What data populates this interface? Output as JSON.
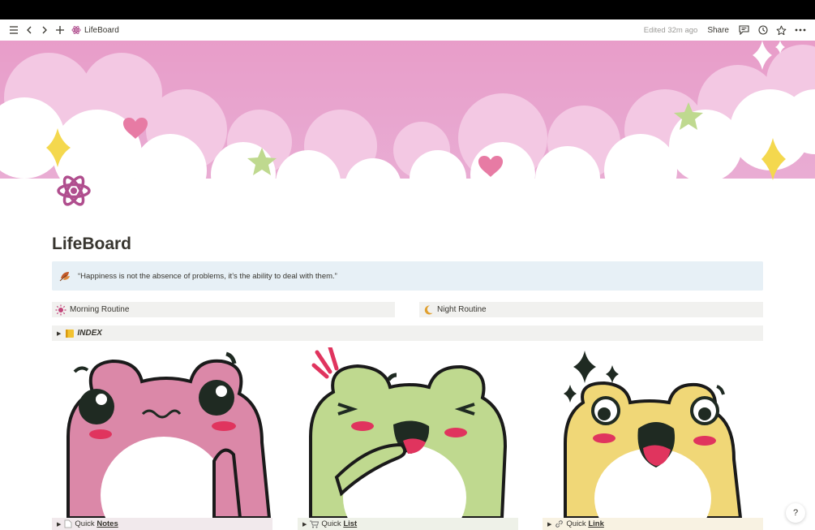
{
  "topbar": {
    "page_name": "LifeBoard",
    "edited": "Edited 32m ago",
    "share": "Share"
  },
  "page": {
    "title": "LifeBoard",
    "quote": "“Happiness is not the absence of problems, it’s the ability to deal with them.”"
  },
  "routines": {
    "morning": "Morning Routine",
    "night": "Night Routine"
  },
  "index": {
    "label": "INDEX"
  },
  "quick": {
    "notes_prefix": "Quick ",
    "notes": "Notes",
    "list_prefix": "Quick ",
    "list": "List",
    "link_prefix": "Quick ",
    "link": "Link"
  },
  "help": "?",
  "colors": {
    "cover_pink": "#e6a3cf",
    "callout_bg": "#e7f0f6",
    "block_bg": "#f1f1ef",
    "frog_pink": "#db88a8",
    "frog_green": "#bfd98f",
    "frog_yellow": "#f0d777",
    "icon_magenta": "#b04e8e"
  },
  "icons": [
    "menu-icon",
    "back-icon",
    "forward-icon",
    "plus-icon",
    "atom-icon",
    "comment-icon",
    "clock-icon",
    "star-icon",
    "more-icon",
    "sun-icon",
    "moon-icon",
    "leaf-icon",
    "notebook-icon",
    "page-icon",
    "cart-icon",
    "link-icon"
  ]
}
